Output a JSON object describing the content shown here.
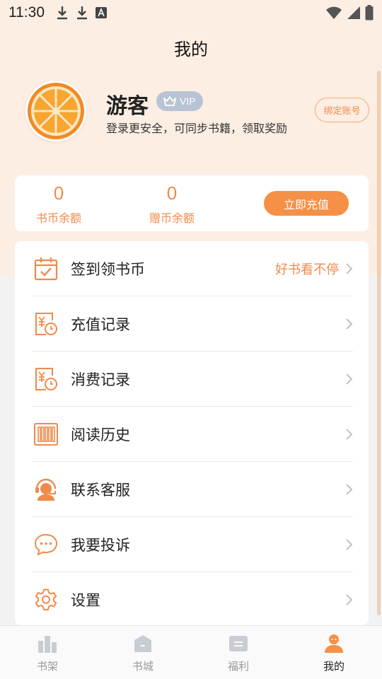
{
  "status_bar": {
    "time": "11:30"
  },
  "page": {
    "title": "我的"
  },
  "profile": {
    "nickname": "游客",
    "vip_label": "VIP",
    "login_tip": "登录更安全，可同步书籍，领取奖励",
    "bind_button": "绑定账号"
  },
  "balance": {
    "coins_value": "0",
    "coins_label": "书币余额",
    "gift_value": "0",
    "gift_label": "赠币余额",
    "recharge_button": "立即充值"
  },
  "menu": [
    {
      "label": "签到领书币",
      "extra": "好书看不停",
      "icon": "calendar-check-icon"
    },
    {
      "label": "充值记录",
      "icon": "recharge-record-icon"
    },
    {
      "label": "消费记录",
      "icon": "consume-record-icon"
    },
    {
      "label": "阅读历史",
      "icon": "bookshelf-history-icon"
    },
    {
      "label": "联系客服",
      "icon": "customer-service-icon"
    },
    {
      "label": "我要投诉",
      "icon": "chat-bubble-icon"
    },
    {
      "label": "设置",
      "icon": "gear-icon"
    }
  ],
  "tabs": [
    {
      "label": "书架",
      "icon": "bookshelf-icon"
    },
    {
      "label": "书城",
      "icon": "bookstore-icon"
    },
    {
      "label": "福利",
      "icon": "welfare-icon"
    },
    {
      "label": "我的",
      "icon": "profile-icon",
      "active": true
    }
  ],
  "colors": {
    "accent": "#f08a4b",
    "header_bg": "#fdeee3",
    "page_bg": "#f2f2f2"
  }
}
